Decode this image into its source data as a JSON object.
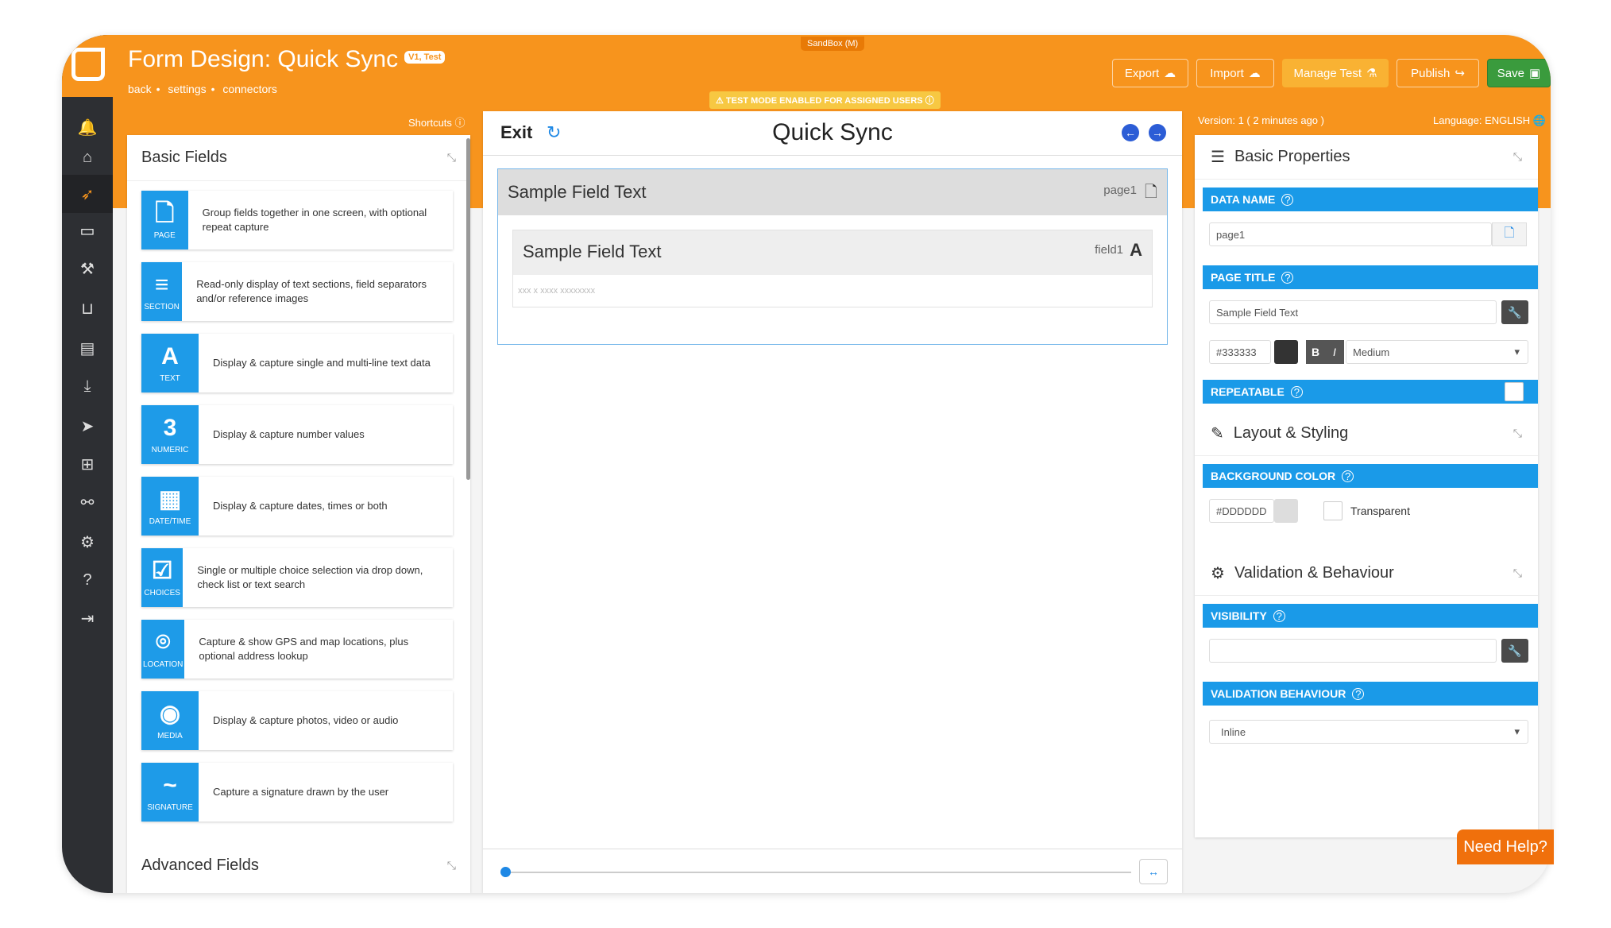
{
  "header": {
    "title": "Form Design: Quick Sync",
    "version_badge": "V1, Test",
    "breadcrumbs": [
      "back",
      "settings",
      "connectors"
    ],
    "sandbox_label": "SandBox (M)",
    "test_mode_label": "TEST MODE ENABLED FOR ASSIGNED USERS",
    "buttons": {
      "export": "Export",
      "import": "Import",
      "manage_test": "Manage Test",
      "publish": "Publish",
      "save": "Save"
    },
    "shortcuts": "Shortcuts",
    "version_info": "Version: 1 ( 2 minutes ago )",
    "language": "Language: ENGLISH"
  },
  "sidebar": {
    "icons": [
      "bell-icon",
      "home-icon",
      "rocket-icon",
      "devices-icon",
      "wrench-icon",
      "basket-icon",
      "table-icon",
      "download-icon",
      "send-icon",
      "sitemap-icon",
      "handshake-icon",
      "gears-icon",
      "help-icon",
      "logout-icon"
    ]
  },
  "left_panel": {
    "title": "Basic Fields",
    "advanced_title": "Advanced Fields",
    "fields": [
      {
        "glyph": "🗋",
        "label": "PAGE",
        "desc": "Group fields together in one screen, with optional repeat capture"
      },
      {
        "glyph": "≡",
        "label": "SECTION",
        "desc": "Read-only display of text sections, field separators and/or reference images"
      },
      {
        "glyph": "A",
        "label": "TEXT",
        "desc": "Display & capture single and multi-line text data"
      },
      {
        "glyph": "3",
        "label": "NUMERIC",
        "desc": "Display & capture number values"
      },
      {
        "glyph": "▦",
        "label": "DATE/TIME",
        "desc": "Display & capture dates, times or both"
      },
      {
        "glyph": "☑",
        "label": "CHOICES",
        "desc": "Single or multiple choice selection via drop down, check list or text search"
      },
      {
        "glyph": "⌾",
        "label": "LOCATION",
        "desc": "Capture & show GPS and map locations, plus optional address lookup"
      },
      {
        "glyph": "◉",
        "label": "MEDIA",
        "desc": "Display & capture photos, video or audio"
      },
      {
        "glyph": "~",
        "label": "SIGNATURE",
        "desc": "Capture a signature drawn by the user"
      }
    ]
  },
  "center": {
    "exit_label": "Exit",
    "form_title": "Quick Sync",
    "page": {
      "title": "Sample Field Text",
      "name": "page1"
    },
    "field": {
      "title": "Sample Field Text",
      "name": "field1",
      "placeholder": "xxx x xxxx xxxxxxxx"
    }
  },
  "right_panel": {
    "basic_properties": "Basic Properties",
    "data_name_label": "DATA NAME",
    "data_name_value": "page1",
    "page_title_label": "PAGE TITLE",
    "page_title_value": "Sample Field Text",
    "text_color": "#333333",
    "bold_label": "B",
    "italic_label": "I",
    "font_size": "Medium",
    "repeatable_label": "REPEATABLE",
    "layout_styling": "Layout & Styling",
    "bg_color_label": "BACKGROUND COLOR",
    "bg_color_value": "#DDDDDD",
    "transparent_label": "Transparent",
    "validation_behaviour_section": "Validation & Behaviour",
    "visibility_label": "VISIBILITY",
    "visibility_value": "",
    "validation_behaviour_label": "VALIDATION BEHAVIOUR",
    "validation_behaviour_value": "Inline"
  },
  "need_help": "Need Help?",
  "colors": {
    "accent": "#f7941d",
    "blue": "#1a9ae8",
    "save": "#3a9b3d",
    "sidebar": "#2d2f33"
  }
}
